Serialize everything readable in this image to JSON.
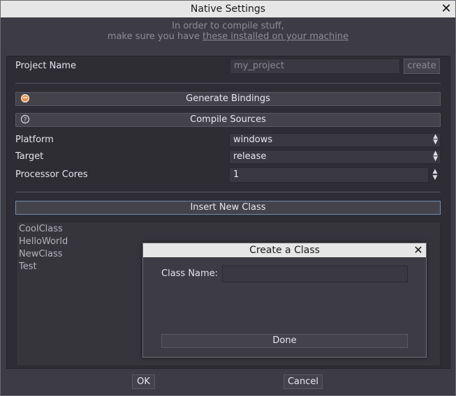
{
  "window": {
    "title": "Native Settings"
  },
  "hint": {
    "line1": "In order to compile stuff,",
    "line2_prefix": "make sure you have ",
    "line2_link": "these installed on your machine"
  },
  "project": {
    "label": "Project Name",
    "value": "my_project",
    "create_label": "create"
  },
  "buttons": {
    "generate_bindings": "Generate Bindings",
    "compile_sources": "Compile Sources",
    "insert_new_class": "Insert New Class",
    "ok": "OK",
    "cancel": "Cancel"
  },
  "settings": {
    "platform": {
      "label": "Platform",
      "value": "windows"
    },
    "target": {
      "label": "Target",
      "value": "release"
    },
    "cores": {
      "label": "Processor Cores",
      "value": "1"
    }
  },
  "classes": [
    "CoolClass",
    "HelloWorld",
    "NewClass",
    "Test"
  ],
  "dialog": {
    "title": "Create a Class",
    "field_label": "Class Name:",
    "field_value": "",
    "done_label": "Done"
  }
}
